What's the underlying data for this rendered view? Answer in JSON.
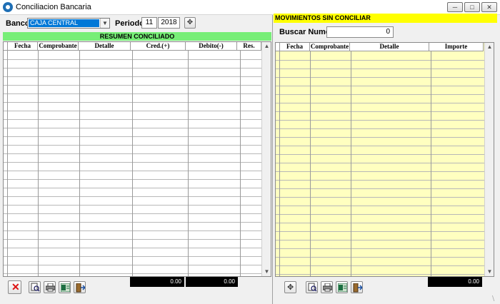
{
  "window": {
    "title": "Conciliacion Bancaria",
    "controls": [
      "minimize",
      "maximize",
      "close"
    ]
  },
  "header": {
    "banco_label": "Banco:",
    "banco_value": "CAJA CENTRAL",
    "periodo_label": "Periodo:",
    "periodo_month": "11",
    "periodo_year": "2018"
  },
  "left_panel": {
    "title": "RESUMEN CONCILIADO",
    "columns": [
      "Fecha",
      "Comprobante",
      "Detalle",
      "Cred.(+)",
      "Debito(-)",
      "Res."
    ],
    "total_credit": "0.00",
    "total_debit": "0.00",
    "toolbar": [
      "delete-icon",
      "preview-icon",
      "print-icon",
      "export-excel-icon",
      "exit-icon"
    ]
  },
  "right_panel": {
    "title": "MOVIMIENTOS SIN CONCILIAR",
    "search_label": "Buscar Numero:",
    "search_value": "0",
    "columns": [
      "Fecha",
      "Comprobante",
      "Detalle",
      "Importe"
    ],
    "total": "0.00",
    "toolbar": [
      "add-icon",
      "preview-icon",
      "print-icon",
      "export-excel-icon",
      "exit-icon"
    ]
  },
  "colors": {
    "left_banner": "#77ee77",
    "right_banner": "#ffff00",
    "right_grid_bg": "#ffffc0",
    "selection": "#0078d7"
  }
}
